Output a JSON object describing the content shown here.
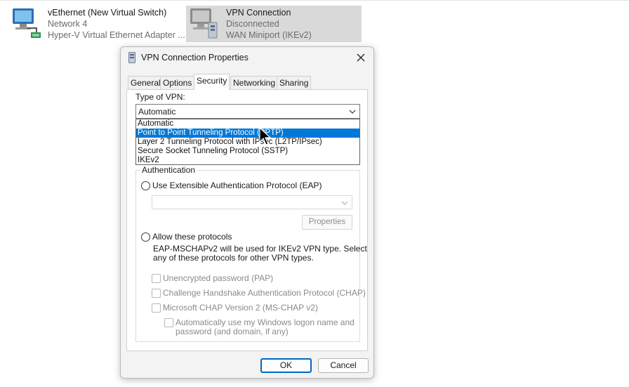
{
  "connections": [
    {
      "name": "vEthernet (New Virtual Switch)",
      "network": "Network 4",
      "adapter": "Hyper-V Virtual Ethernet Adapter ..."
    },
    {
      "name": "VPN Connection",
      "network": "Disconnected",
      "adapter": "WAN Miniport (IKEv2)"
    }
  ],
  "dialog": {
    "title": "VPN Connection Properties",
    "tabs": [
      "General",
      "Options",
      "Security",
      "Networking",
      "Sharing"
    ],
    "active_tab": "Security",
    "type_of_vpn_label": "Type of VPN:",
    "vpn_type_value": "Automatic",
    "vpn_type_options": [
      "Automatic",
      "Point to Point Tunneling Protocol (PPTP)",
      "Layer 2 Tunneling Protocol with IPsec (L2TP/IPsec)",
      "Secure Socket Tunneling Protocol (SSTP)",
      "IKEv2"
    ],
    "highlighted_option": "Point to Point Tunneling Protocol (PPTP)",
    "authentication": {
      "title": "Authentication",
      "eap_radio": "Use Extensible Authentication Protocol (EAP)",
      "eap_select_value": "",
      "properties_button": "Properties",
      "allow_radio": "Allow these protocols",
      "allow_note_1": "EAP-MSCHAPv2 will be used for IKEv2 VPN type. Select",
      "allow_note_2": "any of these protocols for other VPN types.",
      "pap": "Unencrypted password (PAP)",
      "chap": "Challenge Handshake Authentication Protocol (CHAP)",
      "mschap": "Microsoft CHAP Version 2 (MS-CHAP v2)",
      "auto_logon_1": "Automatically use my Windows logon name and",
      "auto_logon_2": "password (and domain, if any)"
    },
    "ok_button": "OK",
    "cancel_button": "Cancel"
  },
  "colors": {
    "accent": "#0078d7",
    "ok_border": "#0067c0",
    "selected_tile": "#d9d9d9"
  }
}
